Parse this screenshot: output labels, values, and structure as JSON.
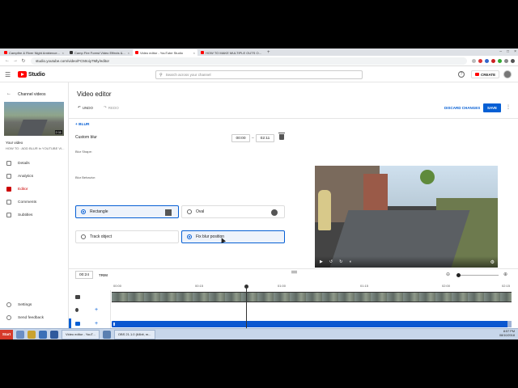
{
  "browser": {
    "tabs": [
      {
        "label": "Campfire & River Night Ambience...",
        "favicon_color": "#ff0000",
        "active": false
      },
      {
        "label": "Camp Fire Forest Video Effects &...",
        "favicon_color": "#333333",
        "active": false
      },
      {
        "label": "Video editor - YouTube Studio",
        "favicon_color": "#ff0000",
        "active": true
      },
      {
        "label": "HOW TO MAKE MULTIPLE OUTS O...",
        "favicon_color": "#ff0000",
        "active": false
      }
    ],
    "new_tab": "+",
    "url": "studio.youtube.com/video/FC50oiy7Mly/editor",
    "window_buttons": [
      "–",
      "□",
      "×"
    ]
  },
  "header": {
    "logo_text": "Studio",
    "search_placeholder": "Search across your channel",
    "create_label": "CREATE"
  },
  "sidebar": {
    "back_label": "Channel videos",
    "thumb_duration": "2:11",
    "your_video_label": "Your video",
    "video_title": "HOW TO : ADD BLUR in YOUTUBE VI...",
    "items": [
      {
        "label": "Details",
        "active": false
      },
      {
        "label": "Analytics",
        "active": false
      },
      {
        "label": "Editor",
        "active": true
      },
      {
        "label": "Comments",
        "active": false
      },
      {
        "label": "Subtitles",
        "active": false
      }
    ],
    "settings_label": "Settings",
    "feedback_label": "Send feedback"
  },
  "editor": {
    "title": "Video editor",
    "undo_label": "UNDO",
    "redo_label": "REDO",
    "discard_label": "DISCARD CHANGES",
    "save_label": "SAVE",
    "blur_section_label": "+ BLUR",
    "custom_blur_label": "Custom blur",
    "start_time": "00:00",
    "end_time": "02:11",
    "blur_shape_label": "Blur Shape:",
    "shape_rectangle": "Rectangle",
    "shape_oval": "Oval",
    "blur_behavior_label": "Blur Behavior:",
    "behavior_track": "Track object",
    "behavior_fix": "Fix blur position",
    "selected_shape": "Rectangle",
    "selected_behavior": "Fix blur position"
  },
  "timeline": {
    "current_time": "00:24",
    "trim_label": "TRIM",
    "ruler": [
      "00:00",
      "00:15",
      "01:00",
      "01:15",
      "02:00",
      "02:15"
    ]
  },
  "taskbar": {
    "start_label": "Start",
    "buttons": [
      "Video editor - YouT...",
      "OBS 21.1.0 (64bit, m..."
    ],
    "time": "8:57 PM",
    "date": "08/10/2018"
  },
  "colors": {
    "accent": "#065fd4",
    "youtube_red": "#ff0000",
    "blur_track": "#0b57d0"
  }
}
